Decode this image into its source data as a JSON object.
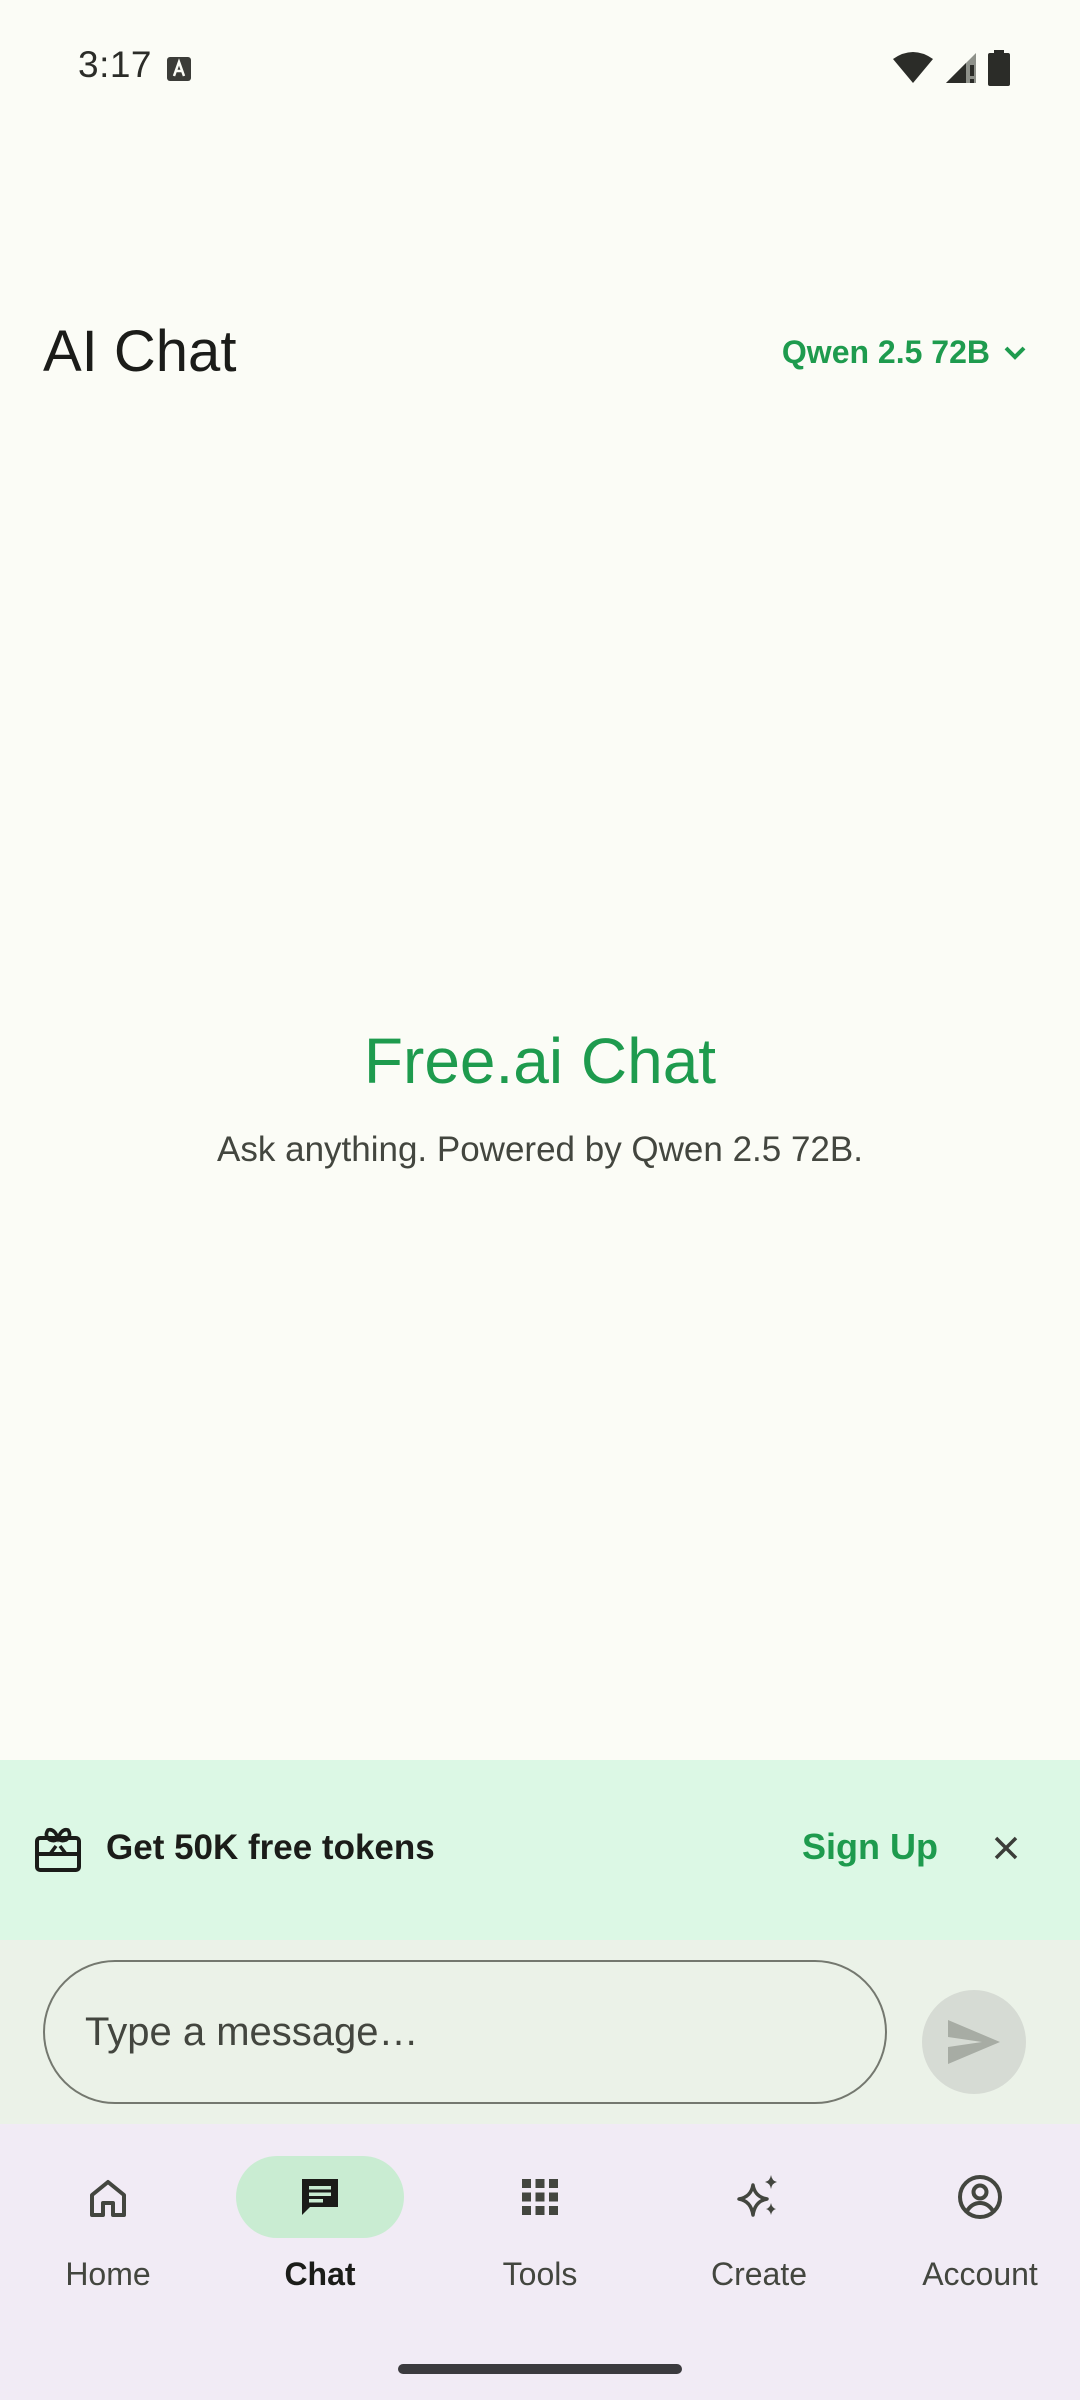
{
  "status_bar": {
    "time": "3:17"
  },
  "header": {
    "title": "AI Chat",
    "model_selector": "Qwen 2.5 72B"
  },
  "hero": {
    "title": "Free.ai Chat",
    "subtitle": "Ask anything. Powered by Qwen 2.5 72B."
  },
  "promo": {
    "text": "Get 50K free tokens",
    "action": "Sign Up",
    "icon": "gift-card-icon"
  },
  "composer": {
    "placeholder": "Type a message…",
    "value": ""
  },
  "nav": {
    "items": [
      {
        "label": "Home",
        "icon": "home-icon"
      },
      {
        "label": "Chat",
        "icon": "chat-icon",
        "active": true
      },
      {
        "label": "Tools",
        "icon": "grid-icon"
      },
      {
        "label": "Create",
        "icon": "sparkle-icon"
      },
      {
        "label": "Account",
        "icon": "account-icon"
      }
    ]
  },
  "colors": {
    "background": "#fbfcf6",
    "accent": "#1e9b4e",
    "promo_background": "#dcf8e5",
    "composer_background": "#ebf2e8",
    "nav_background": "#f1ebf5",
    "nav_active_indicator": "#c9ecd2"
  }
}
